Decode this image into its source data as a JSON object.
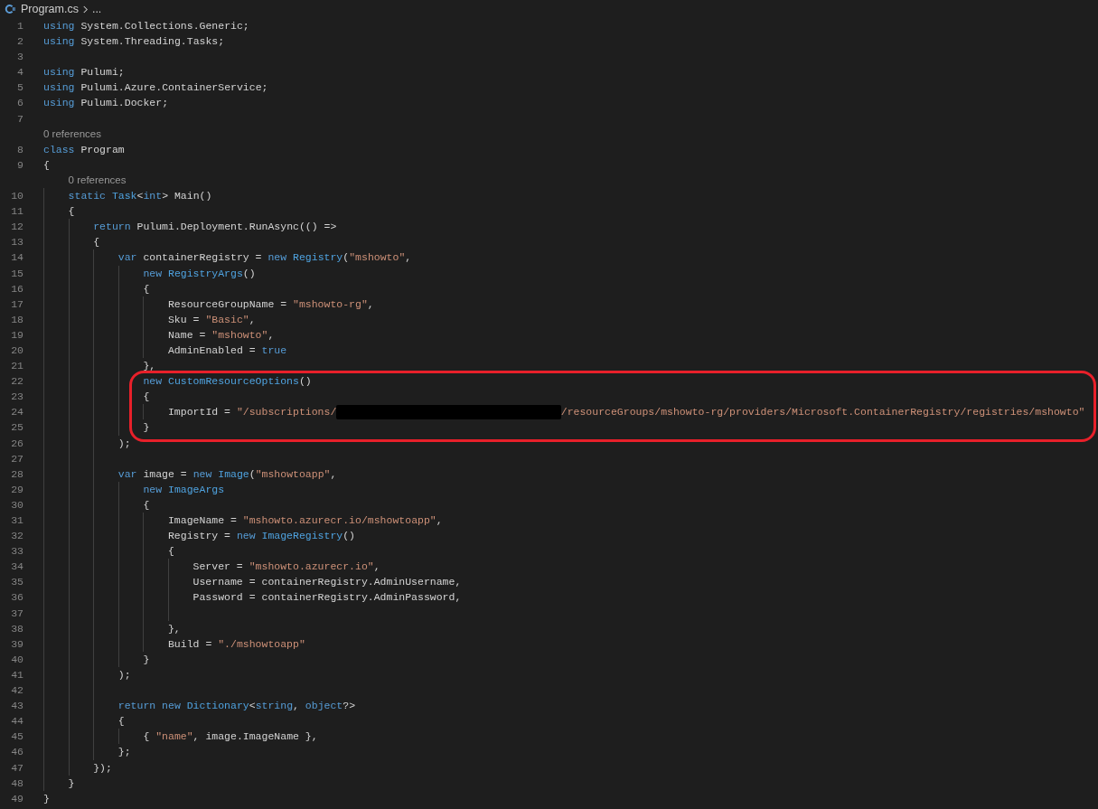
{
  "breadcrumb": {
    "items": [
      "Program.cs",
      "..."
    ]
  },
  "lines": [
    {
      "kind": "code",
      "number": "1",
      "tokens": [
        {
          "kind": "keyword",
          "text": "using"
        },
        {
          "kind": "plain",
          "text": " System.Collections.Generic;"
        }
      ]
    },
    {
      "kind": "code",
      "number": "2",
      "tokens": [
        {
          "kind": "keyword",
          "text": "using"
        },
        {
          "kind": "plain",
          "text": " System.Threading.Tasks;"
        }
      ]
    },
    {
      "kind": "code",
      "number": "3"
    },
    {
      "kind": "code",
      "number": "4",
      "tokens": [
        {
          "kind": "keyword",
          "text": "using"
        },
        {
          "kind": "plain",
          "text": " Pulumi;"
        }
      ]
    },
    {
      "kind": "code",
      "number": "5",
      "tokens": [
        {
          "kind": "keyword",
          "text": "using"
        },
        {
          "kind": "plain",
          "text": " Pulumi.Azure.ContainerService;"
        }
      ]
    },
    {
      "kind": "code",
      "number": "6",
      "tokens": [
        {
          "kind": "keyword",
          "text": "using"
        },
        {
          "kind": "plain",
          "text": " Pulumi.Docker;"
        }
      ]
    },
    {
      "kind": "code",
      "number": "7"
    },
    {
      "kind": "codelens",
      "text": "0 references"
    },
    {
      "kind": "code",
      "number": "8",
      "tokens": [
        {
          "kind": "keyword",
          "text": "class"
        },
        {
          "kind": "plain",
          "text": " Program"
        }
      ]
    },
    {
      "kind": "code",
      "number": "9",
      "tokens": [
        {
          "kind": "plain",
          "text": "{"
        }
      ]
    },
    {
      "kind": "codelens",
      "text": "    0 references"
    },
    {
      "kind": "code",
      "number": "10",
      "tokens": [
        {
          "kind": "keyword",
          "text": "    static "
        },
        {
          "kind": "type",
          "text": "Task"
        },
        {
          "kind": "plain",
          "text": "<"
        },
        {
          "kind": "keyword",
          "text": "int"
        },
        {
          "kind": "plain",
          "text": "> Main()"
        }
      ]
    },
    {
      "kind": "code",
      "number": "11",
      "tokens": [
        {
          "kind": "plain",
          "text": "    {"
        }
      ]
    },
    {
      "kind": "code",
      "number": "12",
      "tokens": [
        {
          "kind": "keyword",
          "text": "        return"
        },
        {
          "kind": "plain",
          "text": " Pulumi.Deployment.RunAsync(() =>"
        }
      ]
    },
    {
      "kind": "code",
      "number": "13",
      "tokens": [
        {
          "kind": "plain",
          "text": "        {"
        }
      ]
    },
    {
      "kind": "code",
      "number": "14",
      "tokens": [
        {
          "kind": "keyword",
          "text": "            var"
        },
        {
          "kind": "plain",
          "text": " containerRegistry = "
        },
        {
          "kind": "keyword",
          "text": "new "
        },
        {
          "kind": "type",
          "text": "Registry"
        },
        {
          "kind": "plain",
          "text": "("
        },
        {
          "kind": "string",
          "text": "\"mshowto\""
        },
        {
          "kind": "plain",
          "text": ","
        }
      ]
    },
    {
      "kind": "code",
      "number": "15",
      "tokens": [
        {
          "kind": "keyword",
          "text": "                new "
        },
        {
          "kind": "type",
          "text": "RegistryArgs"
        },
        {
          "kind": "plain",
          "text": "()"
        }
      ]
    },
    {
      "kind": "code",
      "number": "16",
      "tokens": [
        {
          "kind": "plain",
          "text": "                {"
        }
      ]
    },
    {
      "kind": "code",
      "number": "17",
      "tokens": [
        {
          "kind": "plain",
          "text": "                    ResourceGroupName = "
        },
        {
          "kind": "string",
          "text": "\"mshowto-rg\""
        },
        {
          "kind": "plain",
          "text": ","
        }
      ]
    },
    {
      "kind": "code",
      "number": "18",
      "tokens": [
        {
          "kind": "plain",
          "text": "                    Sku = "
        },
        {
          "kind": "string",
          "text": "\"Basic\""
        },
        {
          "kind": "plain",
          "text": ","
        }
      ]
    },
    {
      "kind": "code",
      "number": "19",
      "tokens": [
        {
          "kind": "plain",
          "text": "                    Name = "
        },
        {
          "kind": "string",
          "text": "\"mshowto\""
        },
        {
          "kind": "plain",
          "text": ","
        }
      ]
    },
    {
      "kind": "code",
      "number": "20",
      "tokens": [
        {
          "kind": "plain",
          "text": "                    AdminEnabled = "
        },
        {
          "kind": "keyword",
          "text": "true"
        }
      ]
    },
    {
      "kind": "code",
      "number": "21",
      "tokens": [
        {
          "kind": "plain",
          "text": "                },"
        }
      ]
    },
    {
      "kind": "code",
      "number": "22",
      "highlighted": true,
      "tokens": [
        {
          "kind": "keyword",
          "text": "                new "
        },
        {
          "kind": "type",
          "text": "CustomResourceOptions"
        },
        {
          "kind": "plain",
          "text": "()"
        }
      ]
    },
    {
      "kind": "code",
      "number": "23",
      "highlighted": true,
      "tokens": [
        {
          "kind": "plain",
          "text": "                {"
        }
      ]
    },
    {
      "kind": "code",
      "number": "24",
      "highlighted": true,
      "tokens": [
        {
          "kind": "plain",
          "text": "                    ImportId = "
        },
        {
          "kind": "string",
          "text": "\"/subscriptions/"
        },
        {
          "kind": "redacted"
        },
        {
          "kind": "string",
          "text": "/resourceGroups/mshowto-rg/providers/Microsoft.ContainerRegistry/registries/mshowto\""
        }
      ]
    },
    {
      "kind": "code",
      "number": "25",
      "highlighted": true,
      "tokens": [
        {
          "kind": "plain",
          "text": "                }"
        }
      ]
    },
    {
      "kind": "code",
      "number": "26",
      "tokens": [
        {
          "kind": "plain",
          "text": "            );"
        }
      ]
    },
    {
      "kind": "code",
      "number": "27"
    },
    {
      "kind": "code",
      "number": "28",
      "tokens": [
        {
          "kind": "keyword",
          "text": "            var"
        },
        {
          "kind": "plain",
          "text": " image = "
        },
        {
          "kind": "keyword",
          "text": "new "
        },
        {
          "kind": "type",
          "text": "Image"
        },
        {
          "kind": "plain",
          "text": "("
        },
        {
          "kind": "string",
          "text": "\"mshowtoapp\""
        },
        {
          "kind": "plain",
          "text": ","
        }
      ]
    },
    {
      "kind": "code",
      "number": "29",
      "tokens": [
        {
          "kind": "keyword",
          "text": "                new "
        },
        {
          "kind": "type",
          "text": "ImageArgs"
        }
      ]
    },
    {
      "kind": "code",
      "number": "30",
      "tokens": [
        {
          "kind": "plain",
          "text": "                {"
        }
      ]
    },
    {
      "kind": "code",
      "number": "31",
      "tokens": [
        {
          "kind": "plain",
          "text": "                    ImageName = "
        },
        {
          "kind": "string",
          "text": "\"mshowto.azurecr.io/mshowtoapp\""
        },
        {
          "kind": "plain",
          "text": ","
        }
      ]
    },
    {
      "kind": "code",
      "number": "32",
      "tokens": [
        {
          "kind": "plain",
          "text": "                    Registry = "
        },
        {
          "kind": "keyword",
          "text": "new "
        },
        {
          "kind": "type",
          "text": "ImageRegistry"
        },
        {
          "kind": "plain",
          "text": "()"
        }
      ]
    },
    {
      "kind": "code",
      "number": "33",
      "tokens": [
        {
          "kind": "plain",
          "text": "                    {"
        }
      ]
    },
    {
      "kind": "code",
      "number": "34",
      "tokens": [
        {
          "kind": "plain",
          "text": "                        Server = "
        },
        {
          "kind": "string",
          "text": "\"mshowto.azurecr.io\""
        },
        {
          "kind": "plain",
          "text": ","
        }
      ]
    },
    {
      "kind": "code",
      "number": "35",
      "tokens": [
        {
          "kind": "plain",
          "text": "                        Username = containerRegistry.AdminUsername,"
        }
      ]
    },
    {
      "kind": "code",
      "number": "36",
      "tokens": [
        {
          "kind": "plain",
          "text": "                        Password = containerRegistry.AdminPassword,"
        }
      ]
    },
    {
      "kind": "code",
      "number": "37"
    },
    {
      "kind": "code",
      "number": "38",
      "tokens": [
        {
          "kind": "plain",
          "text": "                    },"
        }
      ]
    },
    {
      "kind": "code",
      "number": "39",
      "tokens": [
        {
          "kind": "plain",
          "text": "                    Build = "
        },
        {
          "kind": "string",
          "text": "\"./mshowtoapp\""
        }
      ]
    },
    {
      "kind": "code",
      "number": "40",
      "tokens": [
        {
          "kind": "plain",
          "text": "                }"
        }
      ]
    },
    {
      "kind": "code",
      "number": "41",
      "tokens": [
        {
          "kind": "plain",
          "text": "            );"
        }
      ]
    },
    {
      "kind": "code",
      "number": "42"
    },
    {
      "kind": "code",
      "number": "43",
      "tokens": [
        {
          "kind": "keyword",
          "text": "            return new "
        },
        {
          "kind": "type",
          "text": "Dictionary"
        },
        {
          "kind": "plain",
          "text": "<"
        },
        {
          "kind": "keyword",
          "text": "string"
        },
        {
          "kind": "plain",
          "text": ", "
        },
        {
          "kind": "keyword",
          "text": "object"
        },
        {
          "kind": "plain",
          "text": "?>"
        }
      ]
    },
    {
      "kind": "code",
      "number": "44",
      "tokens": [
        {
          "kind": "plain",
          "text": "            {"
        }
      ]
    },
    {
      "kind": "code",
      "number": "45",
      "tokens": [
        {
          "kind": "plain",
          "text": "                { "
        },
        {
          "kind": "string",
          "text": "\"name\""
        },
        {
          "kind": "plain",
          "text": ", image.ImageName },"
        }
      ]
    },
    {
      "kind": "code",
      "number": "46",
      "tokens": [
        {
          "kind": "plain",
          "text": "            };"
        }
      ]
    },
    {
      "kind": "code",
      "number": "47",
      "tokens": [
        {
          "kind": "plain",
          "text": "        });"
        }
      ]
    },
    {
      "kind": "code",
      "number": "48",
      "tokens": [
        {
          "kind": "plain",
          "text": "    }"
        }
      ]
    },
    {
      "kind": "code",
      "number": "49",
      "tokens": [
        {
          "kind": "plain",
          "text": "}"
        }
      ]
    }
  ]
}
